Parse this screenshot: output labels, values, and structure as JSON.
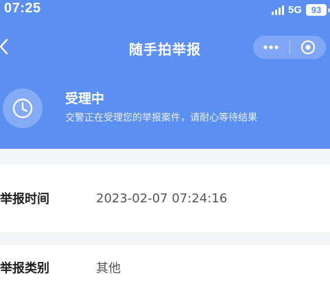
{
  "status_bar": {
    "time": "07:25",
    "network": "5G",
    "battery": "93"
  },
  "nav": {
    "title": "随手拍举报"
  },
  "report_status": {
    "title": "受理中",
    "description": "交警正在受理您的举报案件，请耐心等待结果"
  },
  "details": {
    "time_label": "举报时间",
    "time_value": "2023-02-07 07:24:16",
    "type_label": "举报类别",
    "type_value": "其他"
  },
  "colors": {
    "header_blue": "#5b8ff2",
    "page_bg": "#f4f5f7"
  },
  "icons": {
    "back": "chevron-left-icon",
    "more": "more-dots-icon",
    "close": "target-circle-icon",
    "status": "clock-icon"
  }
}
